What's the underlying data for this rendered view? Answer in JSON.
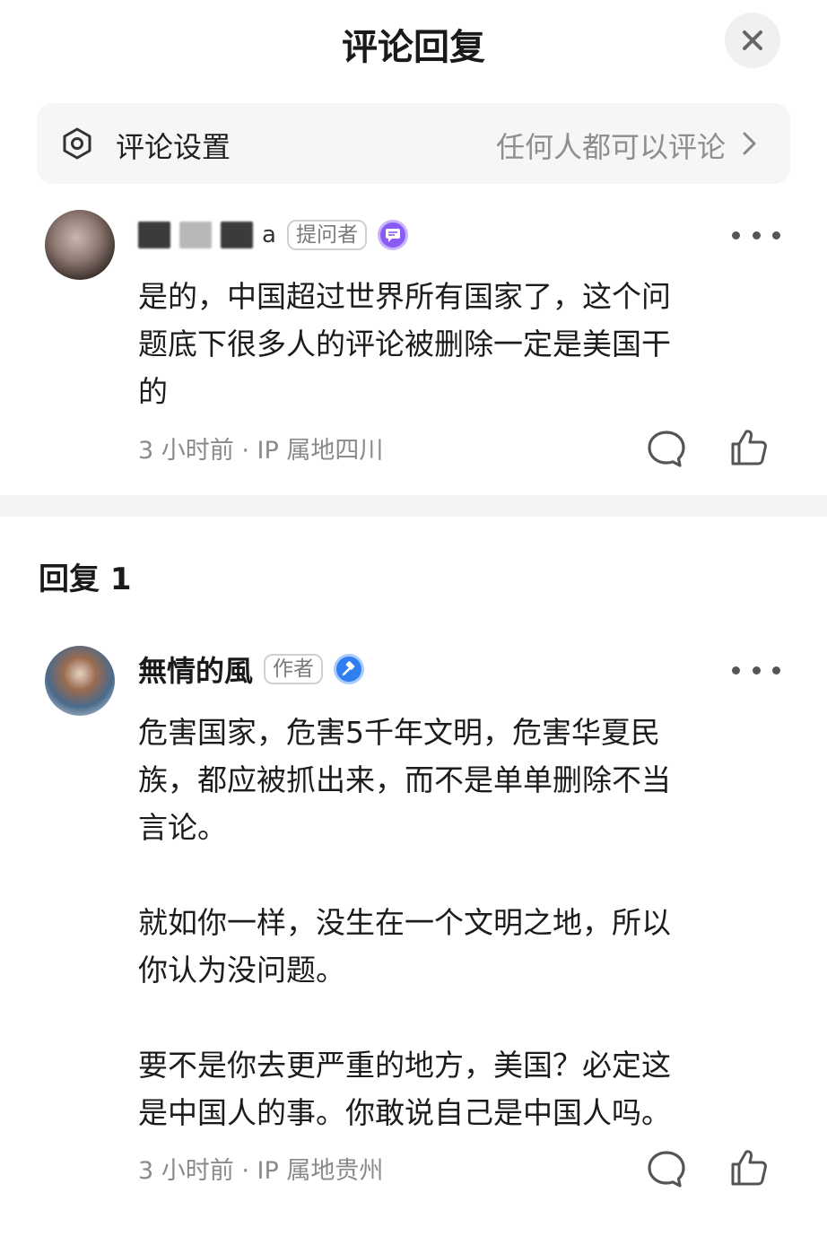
{
  "header": {
    "title": "评论回复",
    "close_icon": "close-icon"
  },
  "settings": {
    "label": "评论设置",
    "value": "任何人都可以评论",
    "icon": "gear-icon"
  },
  "main_comment": {
    "author_redacted": true,
    "author_suffix": "a",
    "role": "提问者",
    "text": "是的，中国超过世界所有国家了，这个问\n题底下很多人的评论被删除一定是美国干\n的",
    "time": "3 小时前",
    "location": "IP 属地四川",
    "meta": "3 小时前 · IP 属地四川"
  },
  "replies": {
    "title": "回复 1",
    "items": [
      {
        "author": "無情的風",
        "role": "作者",
        "text": "危害国家，危害5千年文明，危害华夏民\n族，都应被抓出来，而不是单单删除不当\n言论。\n\n就如你一样，没生在一个文明之地，所以\n你认为没问题。\n\n要不是你去更严重的地方，美国？必定这\n是中国人的事。你敢说自己是中国人吗。",
        "meta": "3 小时前 · IP 属地贵州"
      }
    ]
  },
  "colors": {
    "background": "#ffffff",
    "muted": "#8a8a8a",
    "badge_purple": "#8a5cf5",
    "badge_blue": "#2f7ff0"
  }
}
